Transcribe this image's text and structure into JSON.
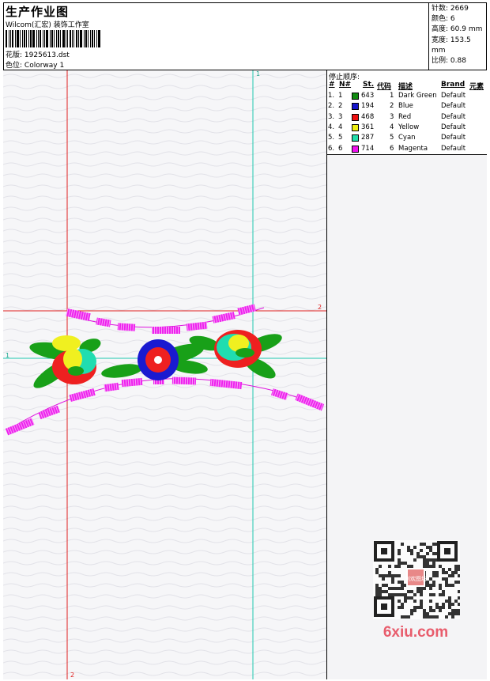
{
  "header": {
    "title": "生产作业图",
    "subtitle": "Wilcom(汇宏) 装饰工作室",
    "design_label": "花版:",
    "design_file": "1925613.dst",
    "colorway_label": "色位:",
    "colorway": "Colorway 1"
  },
  "stats": {
    "stitches_label": "针数:",
    "stitches": "2669",
    "colors_label": "颜色:",
    "colors": "6",
    "height_label": "高度:",
    "height": "60.9 mm",
    "width_label": "宽度:",
    "width": "153.5 mm",
    "scale_label": "比例:",
    "scale": "0.88"
  },
  "stop_sequence": {
    "caption": "停止顺序:",
    "headers": [
      "#",
      "N#",
      "St.",
      "代码",
      "描述",
      "Brand",
      "元素"
    ],
    "rows": [
      {
        "idx": "1.",
        "n": "1",
        "color": "#118c11",
        "st": "643",
        "code": "1",
        "desc": "Dark Green",
        "brand": "Default"
      },
      {
        "idx": "2.",
        "n": "2",
        "color": "#1515cc",
        "st": "194",
        "code": "2",
        "desc": "Blue",
        "brand": "Default"
      },
      {
        "idx": "3.",
        "n": "3",
        "color": "#ee1111",
        "st": "468",
        "code": "3",
        "desc": "Red",
        "brand": "Default"
      },
      {
        "idx": "4.",
        "n": "4",
        "color": "#eeee11",
        "st": "361",
        "code": "4",
        "desc": "Yellow",
        "brand": "Default"
      },
      {
        "idx": "5.",
        "n": "5",
        "color": "#22ddaa",
        "st": "287",
        "code": "5",
        "desc": "Cyan",
        "brand": "Default"
      },
      {
        "idx": "6.",
        "n": "6",
        "color": "#ee11ee",
        "st": "714",
        "code": "6",
        "desc": "Magenta",
        "brand": "Default"
      }
    ]
  },
  "guides": {
    "v1_label": "1",
    "v2_label": "2",
    "h1_label": "1",
    "h2_label": "2"
  },
  "watermark": {
    "site": "6xiu.com",
    "stamp": "刘欢图坊"
  }
}
